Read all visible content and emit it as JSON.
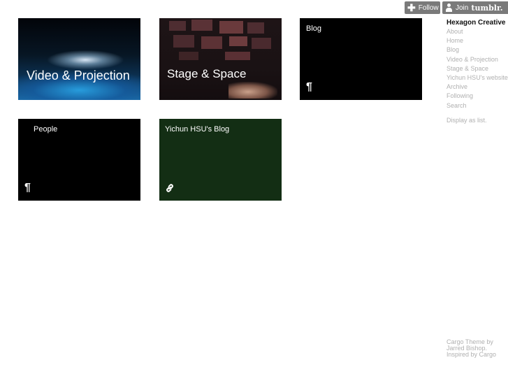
{
  "tumblr": {
    "follow_label": "Follow",
    "join_label": "Join",
    "brand": "tumblr."
  },
  "tiles": [
    {
      "id": "video",
      "title": "Video & Projection",
      "style": "image"
    },
    {
      "id": "stage",
      "title": "Stage & Space",
      "style": "image"
    },
    {
      "id": "blog",
      "title": "Blog",
      "glyph": "¶",
      "icon": "pilcrow-icon",
      "bg": "#000000"
    },
    {
      "id": "people",
      "title": "People",
      "glyph": "¶",
      "icon": "pilcrow-icon",
      "bg": "#000000"
    },
    {
      "id": "yichun",
      "title": "Yichun HSU's Blog",
      "icon": "link-icon",
      "bg": "#132e14"
    }
  ],
  "sidebar": {
    "title": "Hexagon Creative",
    "nav": [
      "About",
      "Home",
      "Blog",
      "Video & Projection",
      "Stage & Space",
      "Yichun HSU's website",
      "Archive",
      "Following",
      "Search"
    ],
    "display_as_list": "Display as list."
  },
  "credits": {
    "line1": "Cargo Theme by",
    "line2": "Jarred Bishop.",
    "line3": "Inspired by Cargo"
  },
  "colors": {
    "nav_text": "#b0b0b0",
    "button_bg": "#7a7a7a",
    "green_tile": "#132e14"
  }
}
